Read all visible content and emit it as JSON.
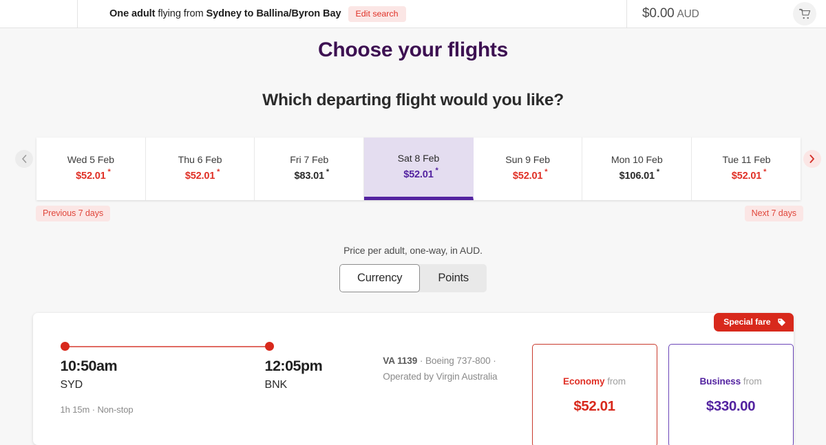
{
  "header": {
    "summary_prefix": "One adult",
    "summary_mid": " flying from ",
    "summary_route": "Sydney to Ballina/Byron Bay",
    "edit_search_label": "Edit search",
    "cart_amount": "$0.00",
    "cart_currency": "AUD",
    "cart_icon": "shopping-cart-icon"
  },
  "page": {
    "title": "Choose your flights",
    "subtitle": "Which departing flight would you like?"
  },
  "date_selector": {
    "prev_arrow_icon": "chevron-left-icon",
    "next_arrow_icon": "chevron-right-icon",
    "previous_range_label": "Previous 7 days",
    "next_range_label": "Next 7 days",
    "asterisk": "*",
    "tabs": [
      {
        "date": "Wed 5 Feb",
        "price": "$52.01",
        "selected": false,
        "highlighted": true
      },
      {
        "date": "Thu 6 Feb",
        "price": "$52.01",
        "selected": false,
        "highlighted": true
      },
      {
        "date": "Fri 7 Feb",
        "price": "$83.01",
        "selected": false,
        "highlighted": false
      },
      {
        "date": "Sat 8 Feb",
        "price": "$52.01",
        "selected": true,
        "highlighted": true
      },
      {
        "date": "Sun 9 Feb",
        "price": "$52.01",
        "selected": false,
        "highlighted": true
      },
      {
        "date": "Mon 10 Feb",
        "price": "$106.01",
        "selected": false,
        "highlighted": false
      },
      {
        "date": "Tue 11 Feb",
        "price": "$52.01",
        "selected": false,
        "highlighted": true
      }
    ]
  },
  "price_toggle": {
    "note": "Price per adult, one-way, in AUD.",
    "options": [
      "Currency",
      "Points"
    ],
    "selected": "Currency"
  },
  "flight": {
    "badge_label": "Special fare",
    "badge_icon": "price-tag-icon",
    "depart_time": "10:50am",
    "depart_code": "SYD",
    "arrive_time": "12:05pm",
    "arrive_code": "BNK",
    "duration": "1h 15m · Non-stop",
    "flight_number": "VA 1139",
    "aircraft": " · Boeing 737-800 ·",
    "operator": "Operated by Virgin Australia",
    "fares": [
      {
        "cabin": "Economy",
        "from_label": " from",
        "price": "$52.01",
        "accent": "#d8291c"
      },
      {
        "cabin": "Business",
        "from_label": " from",
        "price": "$330.00",
        "accent": "#5323a0"
      }
    ]
  },
  "colors": {
    "brand_purple": "#3d1152",
    "accent_purple": "#5323a0",
    "accent_red": "#d8291c",
    "pill_pink": "#fbe6e5",
    "page_bg": "#f7f7f7"
  }
}
